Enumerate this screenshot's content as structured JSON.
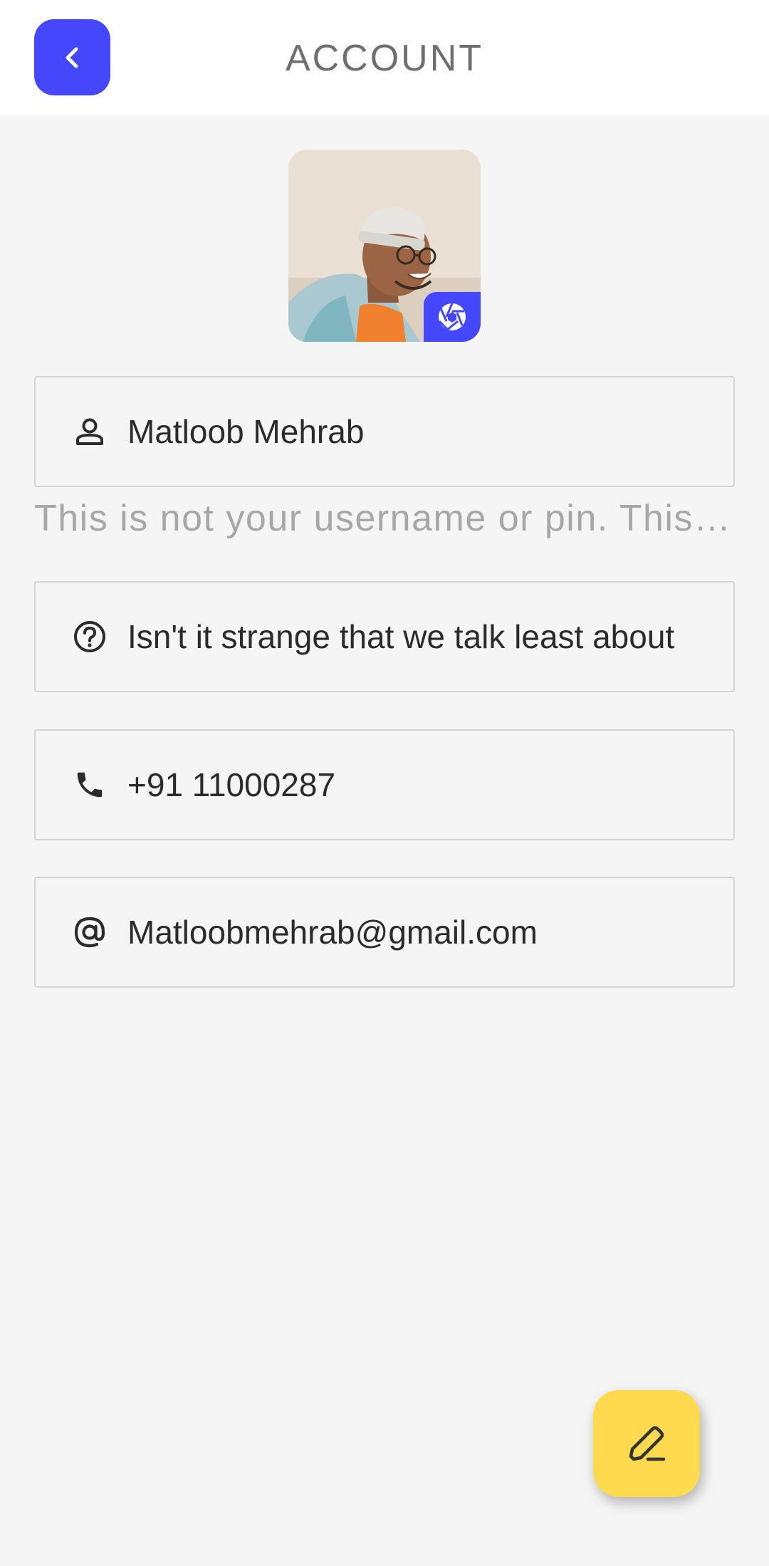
{
  "header": {
    "title": "ACCOUNT",
    "back_icon": "chevron-left-icon"
  },
  "profile": {
    "avatar_icon": "profile-photo",
    "camera_icon": "camera-aperture-icon"
  },
  "fields": {
    "name": {
      "icon": "person-icon",
      "value": "Matloob Mehrab",
      "helper": "This is not your username or pin. This name will be visible to your contacts."
    },
    "about": {
      "icon": "question-circle-icon",
      "value": "Isn't it strange that we talk least about"
    },
    "phone": {
      "icon": "phone-icon",
      "value": "+91 11000287"
    },
    "email": {
      "icon": "at-sign-icon",
      "value": "Matloobmehrab@gmail.com"
    }
  },
  "fab": {
    "icon": "edit-pencil-icon"
  },
  "colors": {
    "accent": "#4447fb",
    "fab": "#ffd94e",
    "background": "#f5f5f5"
  }
}
